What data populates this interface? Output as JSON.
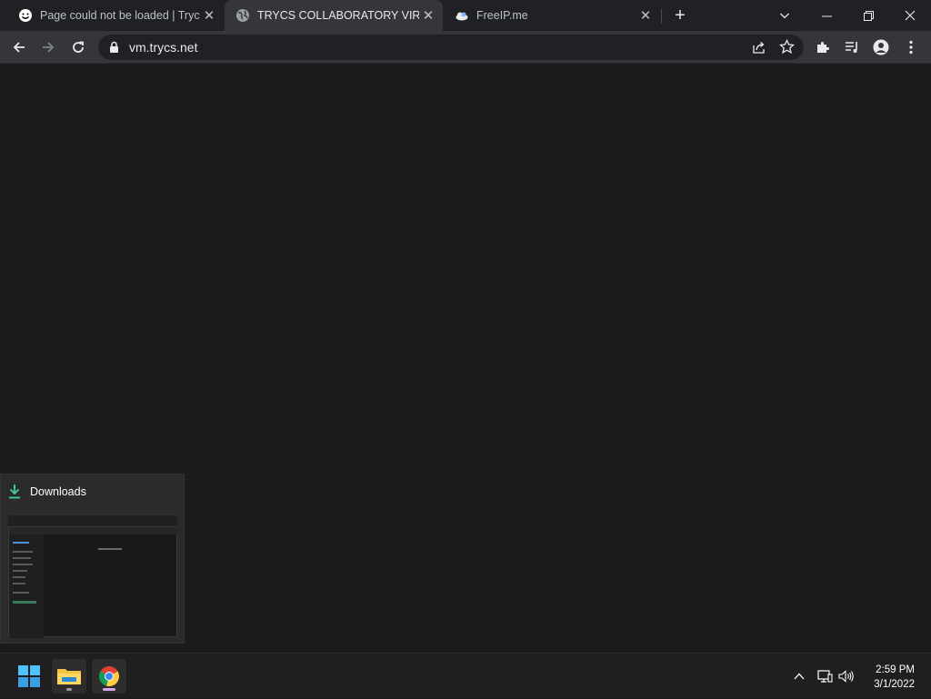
{
  "browser": {
    "tabs": [
      {
        "title": "Page could not be loaded | Trycs",
        "favicon": "smiley-icon"
      },
      {
        "title": "TRYCS COLLABORATORY VIRTUAL",
        "favicon": "globe-icon",
        "active": true
      },
      {
        "title": "FreeIP.me",
        "favicon": "cloud-icon"
      }
    ],
    "url": "vm.trycs.net"
  },
  "preview": {
    "title": "Downloads"
  },
  "taskbar": {
    "time": "2:59 PM",
    "date": "3/1/2022"
  },
  "colors": {
    "accent": "#1a73e8",
    "bg": "#1c1c1e",
    "tabstrip": "#202124",
    "toolbar": "#35363a"
  }
}
